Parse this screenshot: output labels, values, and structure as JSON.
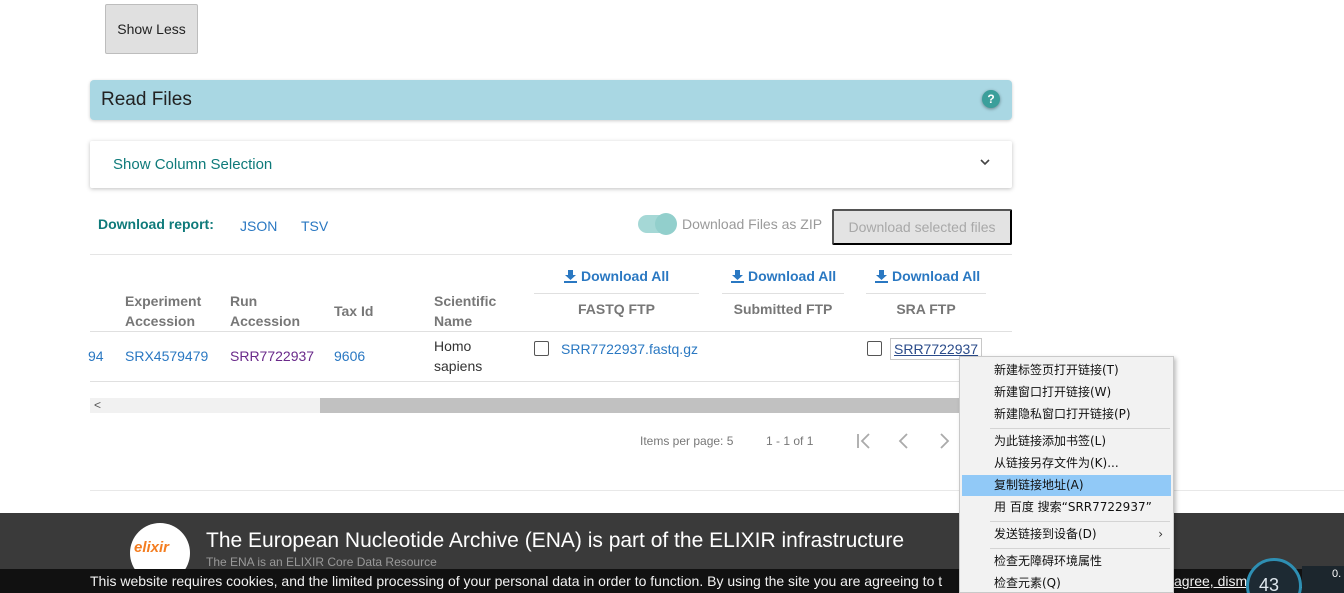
{
  "show_less": "Show Less",
  "read_files": {
    "title": "Read Files",
    "help": "?"
  },
  "column_selection": {
    "label": "Show Column Selection"
  },
  "download_report": {
    "label": "Download report:",
    "json": "JSON",
    "tsv": "TSV"
  },
  "zip_toggle": {
    "label": "Download Files as ZIP",
    "on": true
  },
  "download_selected": "Download selected files",
  "table": {
    "download_all": [
      "Download All",
      "Download All",
      "Download All"
    ],
    "headers": {
      "experiment_accession": [
        "Experiment",
        "Accession"
      ],
      "run_accession": [
        "Run",
        "Accession"
      ],
      "tax_id": "Tax Id",
      "scientific_name": [
        "Scientific",
        "Name"
      ],
      "fastq_ftp": "FASTQ FTP",
      "submitted_ftp": "Submitted FTP",
      "sra_ftp": "SRA FTP"
    },
    "rows": [
      {
        "clipped_left": "94",
        "experiment_accession": "SRX4579479",
        "run_accession": "SRR7722937",
        "tax_id": "9606",
        "scientific_name": [
          "Homo",
          "sapiens"
        ],
        "fastq_ftp": "SRR7722937.fastq.gz",
        "submitted_ftp": "",
        "sra_ftp": "SRR7722937"
      }
    ]
  },
  "paginator": {
    "items_per_page": "Items per page: 5",
    "range": "1 - 1 of 1"
  },
  "footer": {
    "logo_text": "elixir",
    "headline": "The European Nucleotide Archive (ENA) is part of the ELIXIR infrastructure",
    "subline": "The ENA is an ELIXIR Core Data Resource"
  },
  "cookie": {
    "message": "This website requires cookies, and the limited processing of your personal data in order to function. By using the site you are agreeing to t",
    "tail": "agree, dismiss this banner"
  },
  "system_widget": {
    "percent": "43",
    "net": "0."
  },
  "context_menu": {
    "items": [
      "新建标签页打开链接(T)",
      "新建窗口打开链接(W)",
      "新建隐私窗口打开链接(P)",
      "为此链接添加书签(L)",
      "从链接另存文件为(K)...",
      "复制链接地址(A)",
      "用 百度 搜索“SRR7722937”",
      "发送链接到设备(D)",
      "检查无障碍环境属性",
      "检查元素(Q)"
    ],
    "highlighted_index": 5
  },
  "colors": {
    "header_bg": "#a9d7e3",
    "accent": "#0e7a7a",
    "link": "#2a78c2",
    "menu_highlight": "#91c9f7"
  }
}
